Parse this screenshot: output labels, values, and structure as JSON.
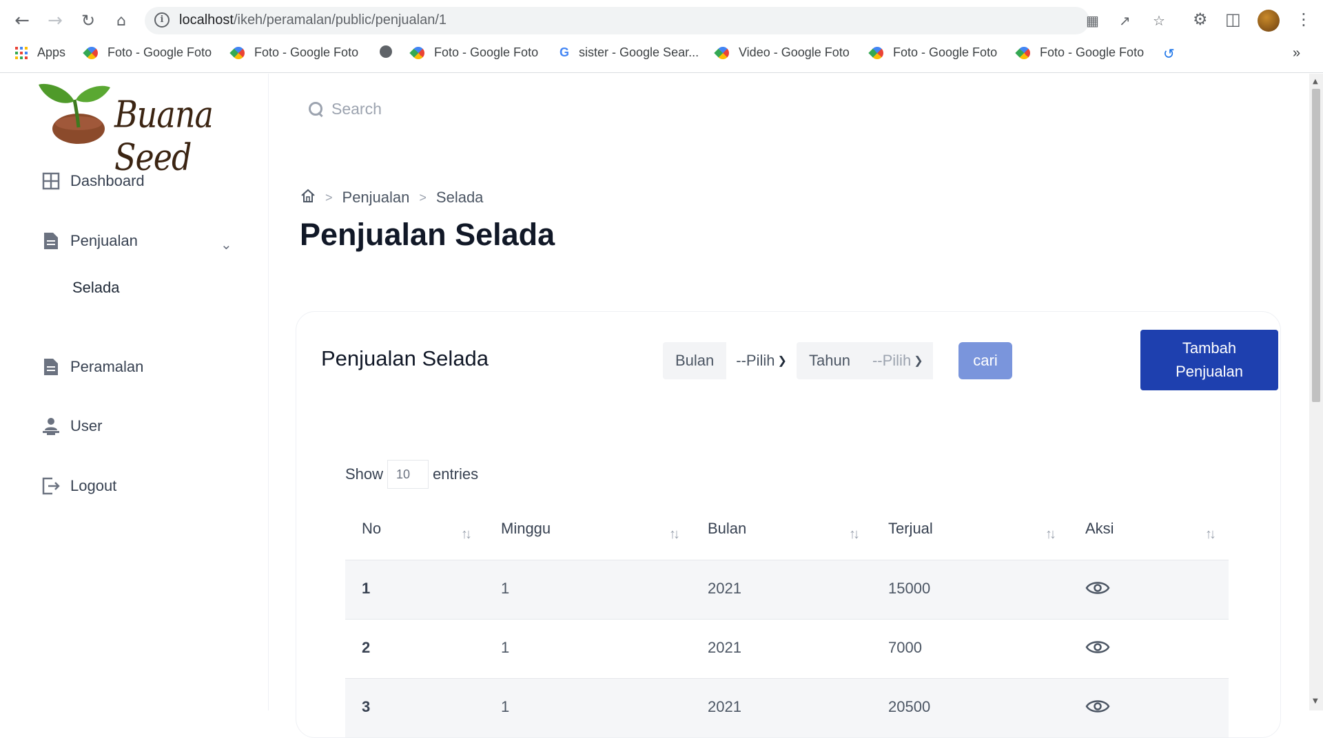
{
  "browser": {
    "url_host": "localhost",
    "url_path": "/ikeh/peramalan/public/penjualan/1",
    "bookmarks": [
      {
        "label": "Apps",
        "icon": "apps-grid-icon"
      },
      {
        "label": "Foto - Google Foto",
        "icon": "google-photos-icon"
      },
      {
        "label": "Foto - Google Foto",
        "icon": "google-photos-icon"
      },
      {
        "label": "",
        "icon": "globe-icon"
      },
      {
        "label": "Foto - Google Foto",
        "icon": "google-photos-icon"
      },
      {
        "label": "sister - Google Sear...",
        "icon": "google-icon"
      },
      {
        "label": "Video - Google Foto",
        "icon": "google-photos-icon"
      },
      {
        "label": "Foto - Google Foto",
        "icon": "google-photos-icon"
      },
      {
        "label": "Foto - Google Foto",
        "icon": "google-photos-icon"
      }
    ],
    "more": "»"
  },
  "sidebar": {
    "logo_text": "Buana Seed",
    "items": [
      {
        "label": "Dashboard",
        "icon": "grid-icon"
      },
      {
        "label": "Penjualan",
        "icon": "document-icon"
      },
      {
        "label": "Peramalan",
        "icon": "document-icon"
      },
      {
        "label": "User",
        "icon": "user-icon"
      },
      {
        "label": "Logout",
        "icon": "logout-icon"
      }
    ],
    "submenu": {
      "label": "Selada"
    }
  },
  "header": {
    "search_placeholder": "Search"
  },
  "breadcrumb": {
    "items": [
      "Penjualan",
      "Selada"
    ]
  },
  "page": {
    "title": "Penjualan Selada"
  },
  "card": {
    "title": "Penjualan Selada",
    "filter_bulan_label": "Bulan",
    "filter_bulan_value": "--Pilih",
    "filter_tahun_label": "Tahun",
    "filter_tahun_value": "--Pilih",
    "search_button": "cari",
    "add_button": "Tambah Penjualan",
    "show_label": "Show",
    "show_value": "10",
    "entries_label": "entries"
  },
  "table": {
    "headers": [
      "No",
      "Minggu",
      "Bulan",
      "Terjual",
      "Aksi"
    ],
    "rows": [
      {
        "no": "1",
        "minggu": "1",
        "bulan": "2021",
        "terjual": "15000"
      },
      {
        "no": "2",
        "minggu": "1",
        "bulan": "2021",
        "terjual": "7000"
      },
      {
        "no": "3",
        "minggu": "1",
        "bulan": "2021",
        "terjual": "20500"
      }
    ]
  },
  "colors": {
    "primary_button": "#1e40af",
    "search_button": "#7a95dc",
    "title_text": "#111827"
  }
}
